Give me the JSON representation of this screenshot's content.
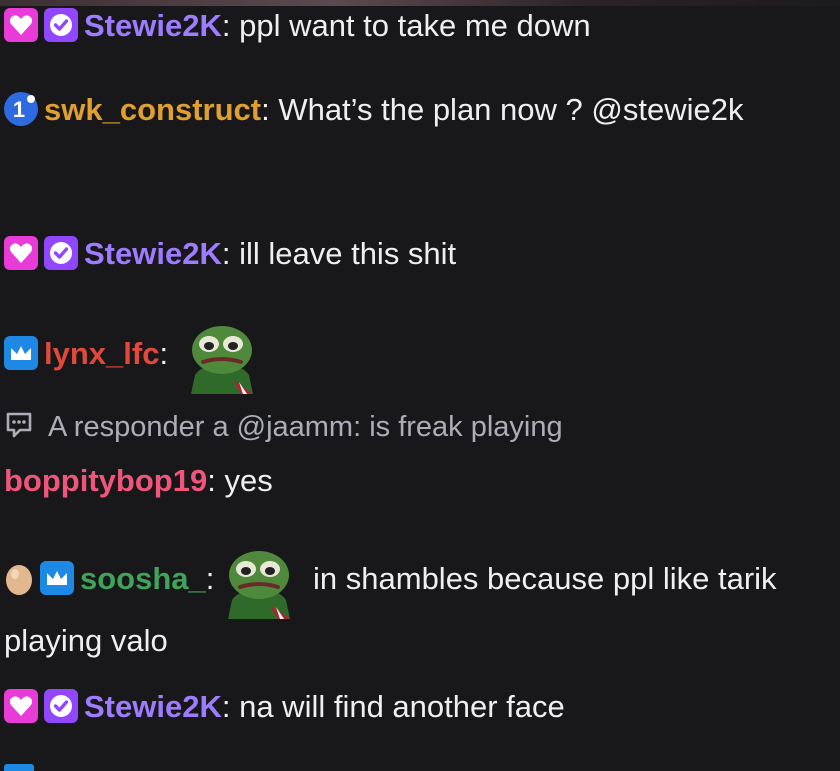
{
  "messages": [
    {
      "id": "m1",
      "badges": [
        "sub-heart-icon",
        "verified-icon"
      ],
      "username": "Stewie2K",
      "username_color": "#9d7cff",
      "separator": ":",
      "text": " ppl want to take me down"
    },
    {
      "id": "m2",
      "badges": [
        "gift-count-icon"
      ],
      "gift_count": "1",
      "username": "swk_construct",
      "username_color": "#e0a030",
      "separator": ":",
      "text": " What’s the plan now ? @stewie2k"
    },
    {
      "id": "m3",
      "badges": [
        "sub-heart-icon",
        "verified-icon"
      ],
      "username": "Stewie2K",
      "username_color": "#9d7cff",
      "separator": ":",
      "text": " ill leave this shit"
    },
    {
      "id": "m4",
      "badges": [
        "prime-crown-icon"
      ],
      "username": "lynx_lfc",
      "username_color": "#e2493b",
      "separator": ":",
      "emote": "pepe-emote",
      "text": ""
    },
    {
      "id": "m5",
      "system": true,
      "icon": "reply-chat-icon",
      "text": "A responder a @jaamm: is freak playing"
    },
    {
      "id": "m6",
      "username": "boppitybop19",
      "username_color": "#f0557a",
      "separator": ":",
      "text": " yes"
    },
    {
      "id": "m7",
      "badges": [
        "egg-icon",
        "prime-crown-icon"
      ],
      "username": "soosha_",
      "username_color": "#3fa35a",
      "separator": ":",
      "emote": "pepe-emote",
      "text": " in shambles because ppl like tarik playing valo"
    },
    {
      "id": "m8",
      "badges": [
        "sub-heart-icon",
        "verified-icon"
      ],
      "username": "Stewie2K",
      "username_color": "#9d7cff",
      "separator": ":",
      "text": " na will find another face"
    }
  ],
  "colors": {
    "background": "#18181b",
    "text": "#efeff1",
    "system_text": "#adadb8",
    "sub_badge": "#e93bd7",
    "verified_badge": "#9147ff",
    "prime_badge": "#1e88e5"
  }
}
